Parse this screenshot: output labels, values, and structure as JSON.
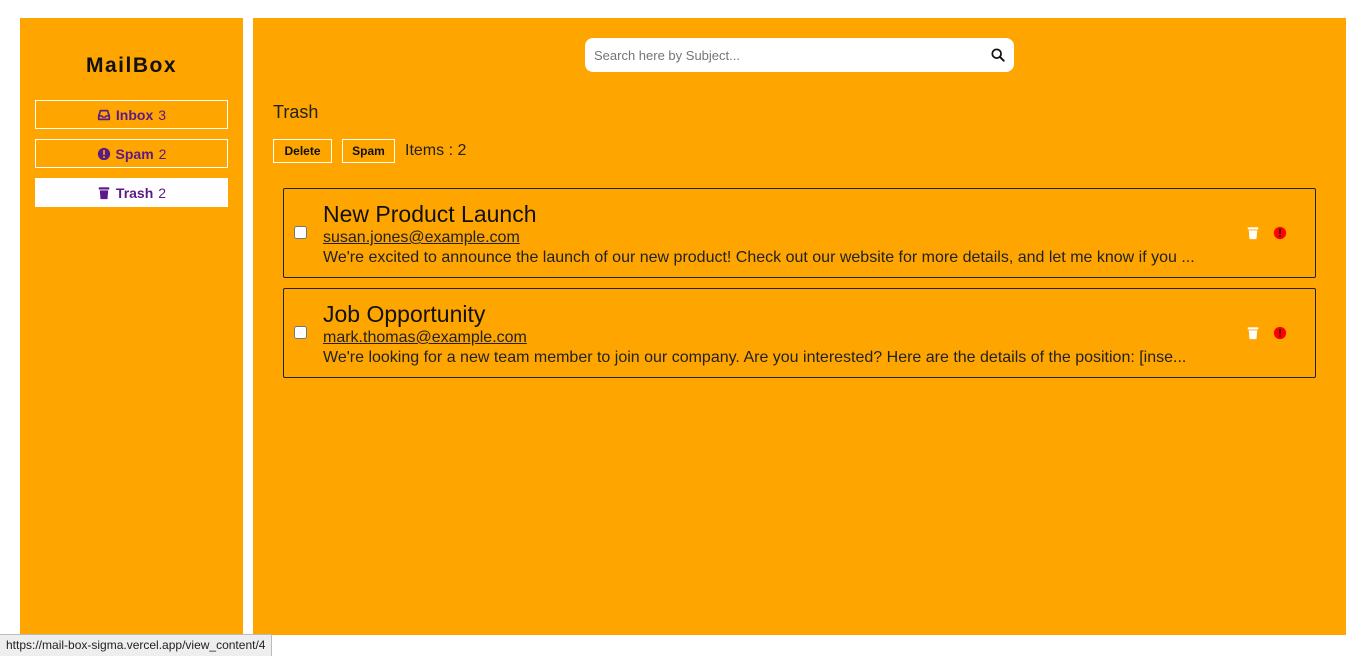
{
  "app": {
    "title": "MailBox"
  },
  "sidebar": {
    "items": [
      {
        "label": "Inbox",
        "count": "3",
        "icon": "inbox-icon",
        "active": false
      },
      {
        "label": "Spam",
        "count": "2",
        "icon": "alert-circle-icon",
        "active": false
      },
      {
        "label": "Trash",
        "count": "2",
        "icon": "trash-icon",
        "active": true
      }
    ]
  },
  "search": {
    "placeholder": "Search here by Subject...",
    "value": "",
    "icon": "search-icon"
  },
  "page": {
    "title": "Trash",
    "delete_label": "Delete",
    "spam_label": "Spam",
    "items_text": "Items : 2"
  },
  "mails": [
    {
      "subject": "New Product Launch",
      "sender": "susan.jones@example.com",
      "preview": "We're excited to announce the launch of our new product! Check out our website for more details, and let me know if you ..."
    },
    {
      "subject": "Job Opportunity",
      "sender": "mark.thomas@example.com",
      "preview": "We're looking for a new team member to join our company. Are you interested? Here are the details of the position: [inse..."
    }
  ],
  "status_bar": {
    "url": "https://mail-box-sigma.vercel.app/view_content/4"
  },
  "colors": {
    "background": "#FFA500",
    "accent": "#5b1a86",
    "spam_icon": "#ff0000",
    "trash_icon": "#ffffff"
  }
}
